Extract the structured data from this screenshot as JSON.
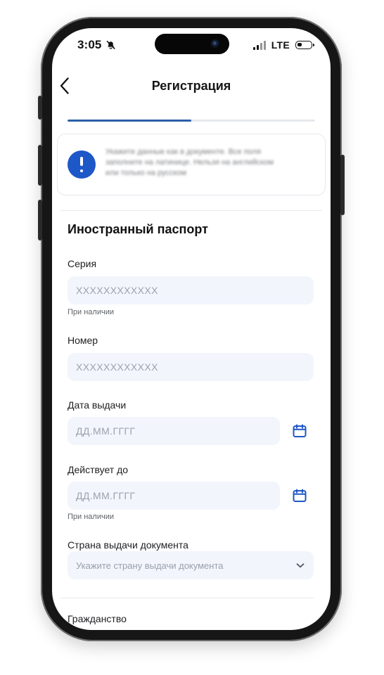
{
  "status_bar": {
    "time": "3:05",
    "network": "LTE"
  },
  "header": {
    "title": "Регистрация"
  },
  "progress": {
    "value": 0.5
  },
  "notice": {
    "text": "Укажите данные как в документе. Все поля заполните на латинице. Нельзя на английском или только на русском"
  },
  "section": {
    "title": "Иностранный паспорт"
  },
  "fields": {
    "series": {
      "label": "Серия",
      "placeholder": "XXXXXXXXXXXX",
      "hint": "При наличии"
    },
    "number": {
      "label": "Номер",
      "placeholder": "XXXXXXXXXXXX"
    },
    "issue_date": {
      "label": "Дата выдачи",
      "placeholder": "ДД.ММ.ГГГГ"
    },
    "valid_until": {
      "label": "Действует до",
      "placeholder": "ДД.ММ.ГГГГ",
      "hint": "При наличии"
    },
    "country": {
      "label": "Страна выдачи документа",
      "placeholder": "Укажите страну выдачи документа"
    },
    "citizenship": {
      "label": "Гражданство"
    }
  },
  "icons": {
    "bell": "bell-slash-icon",
    "signal": "signal-icon",
    "battery": "battery-icon",
    "back": "chevron-left-icon",
    "alert": "exclamation-icon",
    "calendar": "calendar-icon",
    "dropdown": "chevron-down-icon"
  },
  "colors": {
    "accent": "#1e57c7",
    "progress": "#2c5fa6",
    "input_bg": "#f2f5fc",
    "text": "#111111"
  }
}
